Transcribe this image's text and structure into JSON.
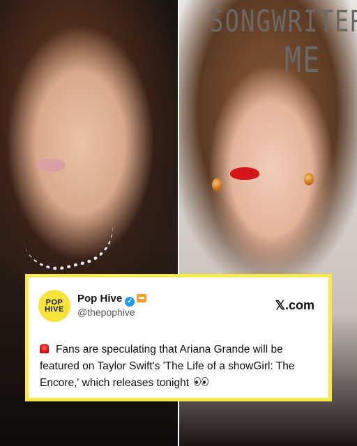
{
  "background": {
    "right_wordmark_line1": "SONGWRITERS",
    "right_wordmark_line2": "ME"
  },
  "card": {
    "border_color": "#f5e94b",
    "logo": {
      "line1": "POP",
      "line2": "HIVE"
    },
    "account": {
      "name": "Pop Hive",
      "handle": "@thepophive",
      "verified": true,
      "badges": [
        "verified-check-icon",
        "affiliate-badge-icon"
      ]
    },
    "source": "𝕏.com",
    "post": {
      "lead_icon": "rotating-siren-icon",
      "text": "Fans are speculating that Ariana Grande will be featured on Taylor Swift's 'The Life of a showGirl: The Encore,' which releases tonight",
      "trailing_icon": "eyes-icon"
    }
  },
  "colors": {
    "accent": "#f5e94b",
    "verified": "#1d9bf0",
    "affiliate": "#f59f2b"
  }
}
